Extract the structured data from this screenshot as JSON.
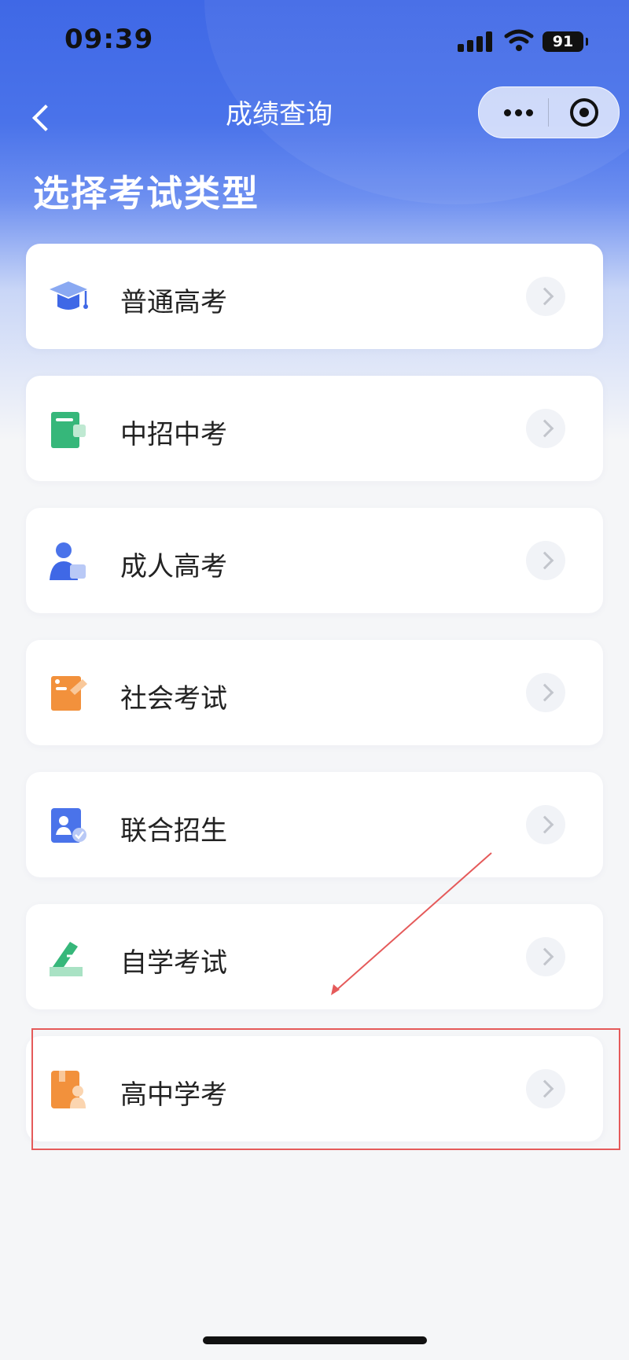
{
  "status_bar": {
    "time": "09:39",
    "battery": "91",
    "icons": [
      "signal-icon",
      "wifi-icon",
      "battery-icon"
    ]
  },
  "nav": {
    "back_icon": "chevron-left-icon",
    "title": "成绩查询",
    "capsule_icons": [
      "more-dots-icon",
      "close-target-icon"
    ]
  },
  "page": {
    "heading": "选择考试类型"
  },
  "exam_types": [
    {
      "label": "普通高考",
      "icon": "graduation-cap-icon"
    },
    {
      "label": "中招中考",
      "icon": "notebook-icon"
    },
    {
      "label": "成人高考",
      "icon": "adult-user-icon"
    },
    {
      "label": "社会考试",
      "icon": "certificate-icon"
    },
    {
      "label": "联合招生",
      "icon": "id-card-check-icon"
    },
    {
      "label": "自学考试",
      "icon": "pen-ticket-icon"
    },
    {
      "label": "高中学考",
      "icon": "school-bag-icon"
    }
  ],
  "annotation": {
    "highlight_color": "#e55a5a",
    "highlighted_item": "高中学考"
  },
  "colors": {
    "primary_blue": "#3f68e6",
    "text_dark": "#222222",
    "background": "#f5f6f8"
  }
}
